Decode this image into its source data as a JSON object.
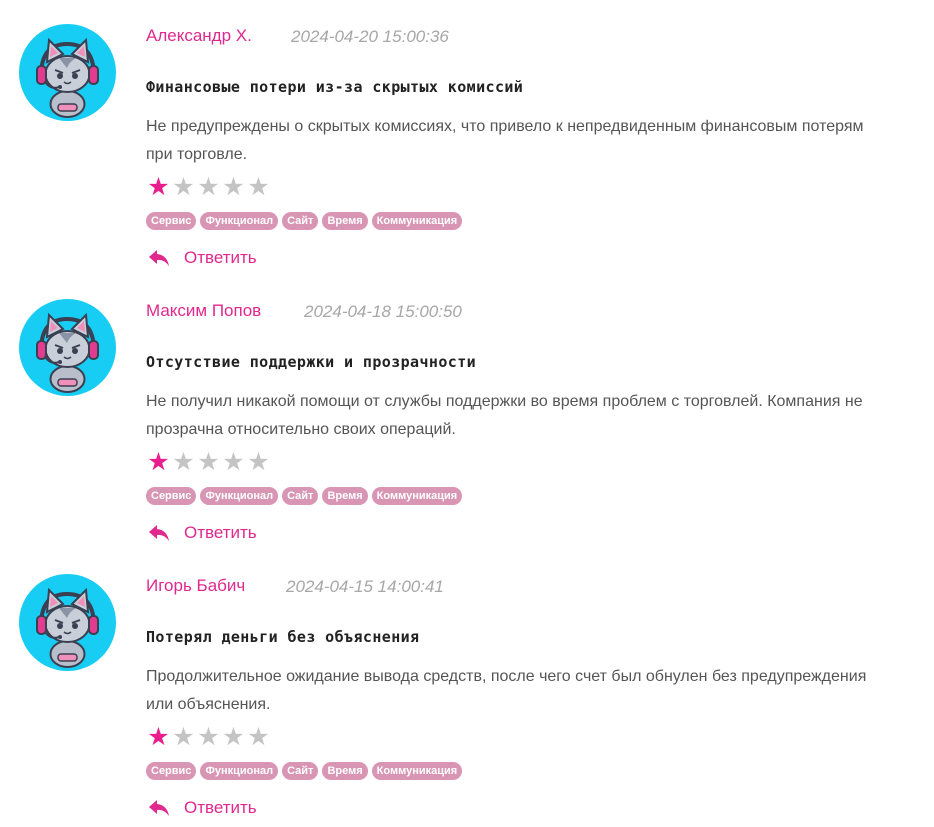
{
  "colors": {
    "accent": "#e0288e",
    "star_on": "#e91e8c",
    "star_off": "#c4c4c4",
    "tag_bg": "#d896b4",
    "avatar_bg": "#18cdf3"
  },
  "reviews": [
    {
      "author": "Александр Х.",
      "date": "2024-04-20 15:00:36",
      "title": "Финансовые потери из-за скрытых комиссий",
      "text": "Не предупреждены о скрытых комиссиях, что привело к непредвиденным финансовым потерям при торговле.",
      "rating": 1,
      "rating_max": 5,
      "tags": [
        "Сервис",
        "Функционал",
        "Сайт",
        "Время",
        "Коммуникация"
      ],
      "reply_label": "Ответить",
      "avatar_icon": "cat-gamer-avatar"
    },
    {
      "author": "Максим Попов",
      "date": "2024-04-18 15:00:50",
      "title": "Отсутствие поддержки и прозрачности",
      "text": "Не получил никакой помощи от службы поддержки во время проблем с торговлей. Компания не прозрачна относительно своих операций.",
      "rating": 1,
      "rating_max": 5,
      "tags": [
        "Сервис",
        "Функционал",
        "Сайт",
        "Время",
        "Коммуникация"
      ],
      "reply_label": "Ответить",
      "avatar_icon": "cat-gamer-avatar"
    },
    {
      "author": "Игорь Бабич",
      "date": "2024-04-15 14:00:41",
      "title": "Потерял деньги без объяснения",
      "text": "Продолжительное ожидание вывода средств, после чего счет был обнулен без предупреждения или объяснения.",
      "rating": 1,
      "rating_max": 5,
      "tags": [
        "Сервис",
        "Функционал",
        "Сайт",
        "Время",
        "Коммуникация"
      ],
      "reply_label": "Ответить",
      "avatar_icon": "cat-gamer-avatar"
    }
  ]
}
